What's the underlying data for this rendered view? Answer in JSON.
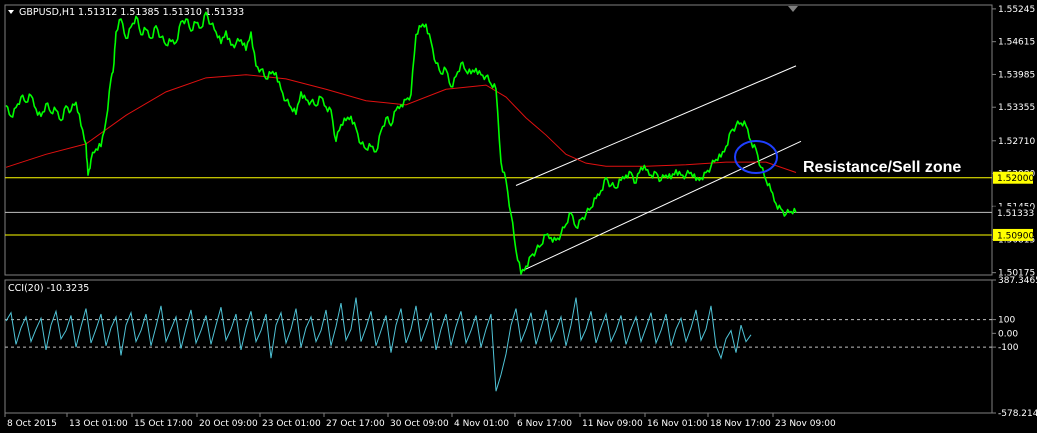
{
  "header": {
    "symbol": "GBPUSD,H1",
    "ohlc": "1.51312 1.51385 1.51310 1.51333"
  },
  "colors": {
    "background": "#000000",
    "price": "#00ff00",
    "ma": "#e01010",
    "channel": "#ffffff",
    "support_resistance": "#ffff00",
    "current_price_line": "#c0c0c0",
    "cci": "#4fc3d6",
    "ellipse": "#1f3fff",
    "axis_text": "#ffffff"
  },
  "chart_data": [
    {
      "type": "line",
      "title": "GBPUSD,H1",
      "ylim": [
        1.5013,
        1.5532
      ],
      "y_ticks": [
        "1.55245",
        "1.54615",
        "1.53985",
        "1.53355",
        "1.52710",
        "1.52080",
        "1.51450",
        "1.50815",
        "1.50175"
      ],
      "x_ticks": [
        "8 Oct 2015",
        "13 Oct 01:00",
        "15 Oct 17:00",
        "20 Oct 09:00",
        "23 Oct 01:00",
        "27 Oct 17:00",
        "30 Oct 09:00",
        "4 Nov 01:00",
        "6 Nov 17:00",
        "11 Nov 09:00",
        "16 Nov 01:00",
        "18 Nov 17:00",
        "23 Nov 09:00"
      ],
      "series": [
        {
          "name": "GBPUSD",
          "x": [
            0,
            5,
            10,
            15,
            20,
            25,
            30,
            35,
            40,
            45,
            50,
            55,
            60,
            65,
            70,
            75,
            80,
            82,
            85,
            90,
            95,
            100,
            105,
            108,
            110,
            115,
            120,
            125,
            130,
            135,
            140,
            145,
            150,
            155,
            160,
            165,
            170,
            175,
            180,
            185,
            190,
            195,
            200,
            205,
            210,
            215,
            220,
            225,
            230,
            235,
            240,
            245,
            250,
            255,
            260,
            265,
            270,
            275,
            280,
            285,
            290,
            295,
            300,
            305,
            310,
            315,
            320,
            325,
            330,
            335,
            340,
            345,
            350,
            355,
            360,
            365,
            370,
            375,
            380,
            385,
            390,
            395,
            400,
            405,
            410,
            415,
            420,
            425,
            430,
            435,
            440,
            445,
            450,
            455,
            460,
            465,
            470,
            475,
            480,
            485,
            490,
            495,
            500,
            505,
            510,
            515,
            520,
            525,
            530,
            535,
            540,
            545,
            550,
            555,
            560,
            565,
            570,
            575,
            580,
            585,
            590,
            595,
            600,
            605,
            610,
            615,
            620,
            625,
            630,
            635,
            640,
            645,
            650,
            655,
            660,
            665,
            670,
            675,
            680,
            685,
            690,
            695,
            700,
            705,
            710,
            715,
            720,
            725,
            730,
            735,
            740,
            745,
            750,
            755,
            760,
            765,
            770,
            775,
            780,
            785,
            790
          ],
          "values": [
            1.5339,
            1.5318,
            1.5335,
            1.5355,
            1.5345,
            1.5358,
            1.5332,
            1.5318,
            1.5342,
            1.5325,
            1.533,
            1.531,
            1.5338,
            1.5329,
            1.5345,
            1.53,
            1.5265,
            1.5205,
            1.5235,
            1.5255,
            1.526,
            1.531,
            1.539,
            1.542,
            1.548,
            1.5505,
            1.5468,
            1.549,
            1.551,
            1.5475,
            1.5485,
            1.5468,
            1.5492,
            1.547,
            1.5455,
            1.5462,
            1.546,
            1.55,
            1.5505,
            1.5482,
            1.5498,
            1.5488,
            1.5518,
            1.5495,
            1.548,
            1.5458,
            1.5482,
            1.5455,
            1.5458,
            1.5465,
            1.5445,
            1.548,
            1.5415,
            1.5408,
            1.539,
            1.54,
            1.5402,
            1.537,
            1.5348,
            1.5335,
            1.5322,
            1.5365,
            1.535,
            1.5346,
            1.5338,
            1.5355,
            1.5336,
            1.533,
            1.527,
            1.5302,
            1.531,
            1.5318,
            1.5295,
            1.5265,
            1.5255,
            1.526,
            1.525,
            1.529,
            1.5315,
            1.53,
            1.533,
            1.534,
            1.535,
            1.536,
            1.5475,
            1.549,
            1.5495,
            1.5462,
            1.542,
            1.54,
            1.5408,
            1.5375,
            1.5395,
            1.542,
            1.5405,
            1.54,
            1.541,
            1.5398,
            1.5395,
            1.538,
            1.537,
            1.523,
            1.5195,
            1.513,
            1.506,
            1.5015,
            1.503,
            1.505,
            1.506,
            1.507,
            1.509,
            1.5085,
            1.508,
            1.5092,
            1.511,
            1.5132,
            1.5105,
            1.512,
            1.513,
            1.5142,
            1.516,
            1.5175,
            1.52,
            1.5185,
            1.518,
            1.5195,
            1.5205,
            1.521,
            1.519,
            1.522,
            1.5215,
            1.5205,
            1.521,
            1.5195,
            1.5205,
            1.5198,
            1.5215,
            1.5205,
            1.5205,
            1.521,
            1.5195,
            1.52,
            1.521,
            1.5222,
            1.5235,
            1.524,
            1.526,
            1.529,
            1.53,
            1.5305,
            1.53,
            1.527,
            1.5255,
            1.522,
            1.5195,
            1.5175,
            1.515,
            1.514,
            1.513,
            1.5135,
            1.5133
          ]
        },
        {
          "name": "MA",
          "x": [
            0,
            40,
            80,
            120,
            160,
            200,
            240,
            280,
            320,
            360,
            400,
            440,
            480,
            500,
            520,
            540,
            560,
            580,
            600,
            640,
            680,
            720,
            760,
            790
          ],
          "values": [
            1.522,
            1.5245,
            1.5265,
            1.532,
            1.5365,
            1.5392,
            1.5398,
            1.539,
            1.537,
            1.5348,
            1.534,
            1.537,
            1.5378,
            1.5355,
            1.5315,
            1.5282,
            1.5245,
            1.5228,
            1.5222,
            1.5222,
            1.5225,
            1.523,
            1.523,
            1.521
          ]
        }
      ],
      "lines": {
        "resistance": 1.52,
        "support": 1.509,
        "current": 1.51333
      },
      "price_labels": {
        "resistance": "1.52000",
        "current": "1.51333",
        "support": "1.50900"
      },
      "channel": {
        "upper": [
          [
            510,
            1.5185
          ],
          [
            790,
            1.5415
          ]
        ],
        "lower": [
          [
            515,
            1.502
          ],
          [
            795,
            1.527
          ]
        ]
      },
      "annotation": "Resistance/Sell zone"
    },
    {
      "type": "line",
      "title": "CCI(20) -10.3235",
      "ylim": [
        -578.214,
        387.3465
      ],
      "y_ticks": [
        "387.3465",
        "100",
        "0.00",
        "-100",
        "-578.214"
      ],
      "levels": [
        100,
        0,
        -100
      ],
      "series": [
        {
          "name": "CCI(20)",
          "x_step": 5,
          "values": [
            90,
            150,
            -80,
            40,
            120,
            -60,
            30,
            110,
            -120,
            60,
            160,
            -40,
            20,
            130,
            -100,
            50,
            180,
            -70,
            30,
            140,
            -90,
            40,
            120,
            -160,
            60,
            150,
            -60,
            20,
            140,
            -90,
            50,
            200,
            -60,
            30,
            120,
            -110,
            40,
            170,
            -70,
            20,
            130,
            -80,
            60,
            190,
            -50,
            30,
            140,
            -120,
            40,
            160,
            -60,
            20,
            140,
            -180,
            60,
            150,
            -70,
            30,
            180,
            -100,
            40,
            120,
            -60,
            20,
            170,
            -90,
            50,
            220,
            -50,
            30,
            260,
            -60,
            40,
            160,
            -90,
            20,
            130,
            -140,
            60,
            180,
            -70,
            30,
            200,
            -60,
            40,
            150,
            -120,
            30,
            140,
            -90,
            50,
            160,
            -70,
            20,
            130,
            -100,
            30,
            140,
            -420,
            -300,
            -150,
            60,
            180,
            -60,
            30,
            150,
            -80,
            40,
            170,
            -60,
            20,
            120,
            -90,
            60,
            260,
            -50,
            30,
            160,
            -70,
            40,
            140,
            -60,
            20,
            130,
            -80,
            30,
            120,
            -60,
            40,
            150,
            -70,
            20,
            140,
            -90,
            30,
            110,
            -60,
            40,
            170,
            -50,
            30,
            200,
            -90,
            -180,
            -40,
            20,
            -140,
            60,
            -60,
            -10.3235
          ]
        }
      ]
    }
  ]
}
